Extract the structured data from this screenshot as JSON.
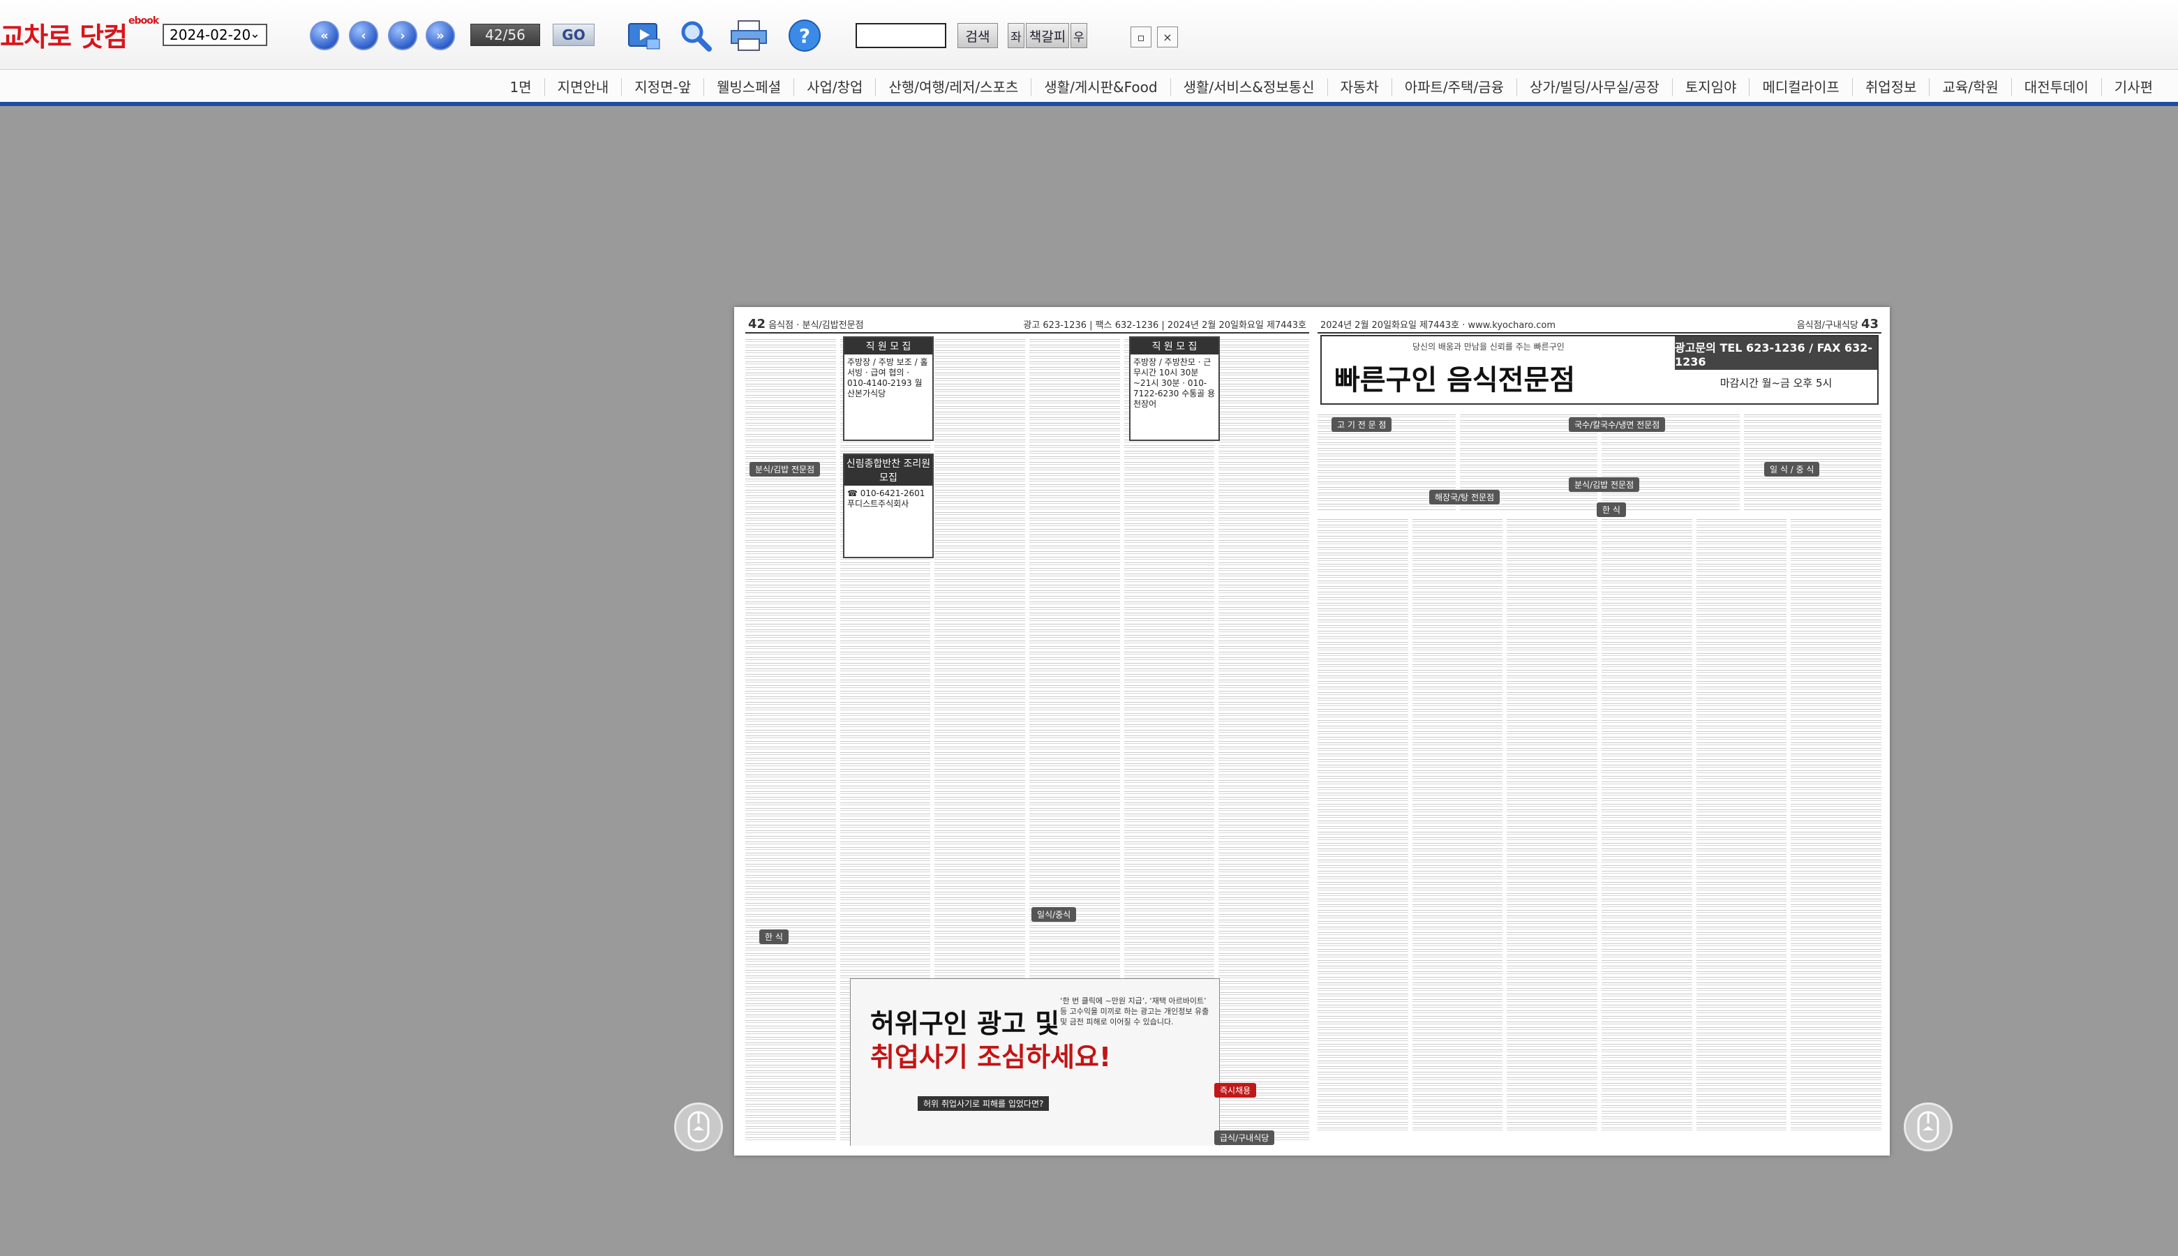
{
  "logo": {
    "text": "교차로 닷컴",
    "sub": "ebook"
  },
  "toolbar": {
    "date_value": "2024-02-20",
    "page_counter": "42/56",
    "go_label": "GO",
    "search_label": "검색",
    "prev_label": "좌",
    "bookmark_label": "책갈피",
    "next_label": "우",
    "search_value": ""
  },
  "menu": {
    "items": [
      "1면",
      "지면안내",
      "지정면-앞",
      "웰빙스페셜",
      "사업/창업",
      "산행/여행/레저/스포츠",
      "생활/게시판&Food",
      "생활/서비스&정보통신",
      "자동차",
      "아파트/주택/금융",
      "상가/빌딩/사무실/공장",
      "토지임야",
      "메디컬라이프",
      "취업정보",
      "교육/학원",
      "대전투데이",
      "기사편"
    ]
  },
  "left_page": {
    "page_no": "42",
    "section": "음식점 · 분식/김밥전문점",
    "header_info": "광고 623-1236 | 팩스 632-1236 | 2024년 2월 20일화요일 제7443호",
    "box_title_1": "직 원 모 집",
    "box_body_1": "주방장 / 주방 보조 / 홀서빙 · 급여 협의 · 010-4140-2193 월산본가식당",
    "box_title_2": "직 원 모 집",
    "box_body_2": "주방장 / 주방찬모 · 근무시간 10시 30분~21시 30분 · 010-7122-6230 수통골 용천장어",
    "box_title_3": "신림종합반찬 조리원 모집",
    "box_body_3": "☎ 010-6421-2601 푸디스트주식회사",
    "tag_bunsik": "분식/김밥 전문점",
    "tag_hansik": "한 식",
    "tag_ilsik": "일식/중식",
    "promo_line1": "허위구인 광고 및",
    "promo_line2": "취업사기 조심하세요!",
    "promo_badge": "허위 취업사기로 피해를 입었다면?",
    "promo_side": "‘한 번 클릭에 ~만원 지급’, ‘재택 아르바이트’ 등 고수익을 미끼로 하는 광고는 개인정보 유출 및 금전 피해로 이어질 수 있습니다."
  },
  "right_page": {
    "page_no": "43",
    "section": "음식점/구내식당",
    "header_info": "2024년 2월 20일화요일 제7443호 · www.kyocharo.com",
    "banner_sub": "당신의 배움과 만남을 신뢰를 주는 빠른구인",
    "banner_title": "빠른구인 음식전문점",
    "banner_contact": "광고문의 TEL 623-1236 / FAX 632-1236",
    "banner_deadline": "마감시간 월~금 오후 5시",
    "tag_goki": "고 기 전 문 점",
    "tag_guksu": "국수/칼국수/냉면 전문점",
    "tag_haejang": "해장국/탕 전문점",
    "tag_bunsik": "분식/김밥 전문점",
    "tag_hansik": "한 식",
    "tag_ilsik": "일 식 / 중 식",
    "tag_jeukshi": "즉시채용",
    "tag_gunae": "급식/구내식당"
  }
}
